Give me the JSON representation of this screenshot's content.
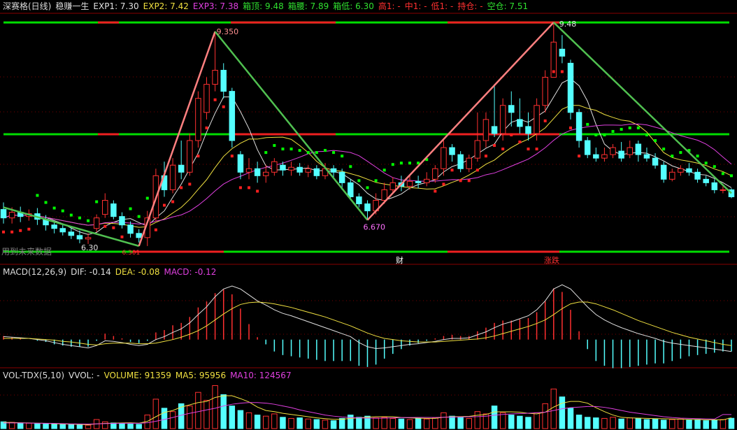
{
  "main_header": {
    "title": "深赛格(日线)",
    "indicator": "稳赚一生",
    "items": [
      {
        "label": "EXP1: 7.30",
        "color": "#e0e0e0"
      },
      {
        "label": "EXP2: 7.42",
        "color": "#f0e040"
      },
      {
        "label": "EXP3: 7.38",
        "color": "#e040e0"
      },
      {
        "label": "箱顶: 9.48",
        "color": "#30e030"
      },
      {
        "label": "箱腰: 7.89",
        "color": "#30e030"
      },
      {
        "label": "箱低: 6.30",
        "color": "#30e030"
      },
      {
        "label": "高1: -",
        "color": "#ff3030"
      },
      {
        "label": "中1: -",
        "color": "#ff3030"
      },
      {
        "label": "低1: -",
        "color": "#ff3030"
      },
      {
        "label": "持仓: -",
        "color": "#ff3030"
      },
      {
        "label": "空仓: 7.51",
        "color": "#30e030"
      }
    ]
  },
  "macd_header": {
    "name": "MACD(12,26,9)",
    "items": [
      {
        "label": "DIF: -0.14",
        "color": "#e0e0e0"
      },
      {
        "label": "DEA: -0.08",
        "color": "#f0e040"
      },
      {
        "label": "MACD: -0.12",
        "color": "#e040e0"
      }
    ]
  },
  "vol_header": {
    "name": "VOL-TDX(5,10)",
    "items": [
      {
        "label": "VVOL: -",
        "color": "#e0e0e0"
      },
      {
        "label": "VOLUME: 91359",
        "color": "#f0e040"
      },
      {
        "label": "MA5: 95956",
        "color": "#f0e040"
      },
      {
        "label": "MA10: 124567",
        "color": "#e040e0"
      }
    ]
  },
  "annotations": {
    "low_left": "6.30",
    "peak_left": "9.350",
    "trough_mid": "6.670",
    "peak_right": "9.48",
    "low_left_label2": "6.301",
    "note_left": "用到未来数据",
    "marker_cai": "财",
    "marker_zd": "涨跌"
  },
  "colors": {
    "up": "#ff3030",
    "down": "#54ffff",
    "box_line": "#00dd00",
    "box_line_red": "#ee2020",
    "zigzag_up": "#ff8080",
    "zigzag_down": "#50c050",
    "dots_green": "#00ff00",
    "dots_red": "#ff2020",
    "exp1": "#e0e0e0",
    "exp2": "#f0e040",
    "exp3": "#e040e0",
    "grid": "#7a0000"
  },
  "chart_data": {
    "type": "candlestick",
    "price_range": [
      6.1,
      9.6
    ],
    "box": {
      "top": 9.48,
      "mid": 7.89,
      "low": 6.3
    },
    "zigzag": [
      {
        "i": 0,
        "v": 6.85
      },
      {
        "i": 16,
        "v": 6.3
      },
      {
        "i": 25,
        "v": 9.35
      },
      {
        "i": 43,
        "v": 6.67
      },
      {
        "i": 65,
        "v": 9.48
      },
      {
        "i": 86,
        "v": 7.05
      }
    ],
    "candles": [
      [
        6.82,
        6.7,
        6.92,
        6.62
      ],
      [
        6.7,
        6.78,
        6.85,
        6.62
      ],
      [
        6.78,
        6.72,
        6.86,
        6.64
      ],
      [
        6.72,
        6.76,
        6.82,
        6.66
      ],
      [
        6.76,
        6.68,
        6.84,
        6.6
      ],
      [
        6.68,
        6.6,
        6.74,
        6.52
      ],
      [
        6.6,
        6.55,
        6.66,
        6.48
      ],
      [
        6.55,
        6.5,
        6.62,
        6.45
      ],
      [
        6.5,
        6.45,
        6.56,
        6.4
      ],
      [
        6.45,
        6.4,
        6.52,
        6.34
      ],
      [
        6.4,
        6.42,
        6.48,
        6.33
      ],
      [
        6.55,
        6.7,
        6.75,
        6.5
      ],
      [
        6.75,
        6.95,
        7.05,
        6.7
      ],
      [
        6.9,
        6.72,
        6.95,
        6.68
      ],
      [
        6.72,
        6.6,
        6.78,
        6.55
      ],
      [
        6.6,
        6.48,
        6.65,
        6.42
      ],
      [
        6.48,
        6.42,
        6.54,
        6.35
      ],
      [
        6.42,
        6.7,
        6.8,
        6.3
      ],
      [
        6.7,
        7.3,
        7.4,
        6.65
      ],
      [
        7.3,
        7.1,
        7.5,
        7.0
      ],
      [
        7.1,
        7.45,
        7.55,
        7.05
      ],
      [
        7.45,
        7.35,
        7.8,
        7.25
      ],
      [
        7.35,
        7.8,
        7.9,
        7.3
      ],
      [
        7.8,
        8.4,
        8.5,
        7.7
      ],
      [
        8.2,
        8.6,
        8.7,
        8.1
      ],
      [
        8.6,
        8.8,
        9.35,
        8.5
      ],
      [
        8.8,
        8.5,
        8.9,
        8.4
      ],
      [
        8.5,
        7.8,
        8.55,
        7.7
      ],
      [
        7.6,
        7.35,
        7.65,
        7.25
      ],
      [
        7.35,
        7.4,
        7.55,
        7.25
      ],
      [
        7.4,
        7.3,
        7.5,
        7.2
      ],
      [
        7.3,
        7.35,
        7.45,
        7.2
      ],
      [
        7.35,
        7.5,
        7.55,
        7.3
      ],
      [
        7.45,
        7.38,
        7.5,
        7.3
      ],
      [
        7.38,
        7.42,
        7.5,
        7.3
      ],
      [
        7.42,
        7.35,
        7.48,
        7.3
      ],
      [
        7.35,
        7.4,
        7.45,
        7.28
      ],
      [
        7.4,
        7.3,
        7.45,
        7.25
      ],
      [
        7.3,
        7.4,
        7.48,
        7.25
      ],
      [
        7.4,
        7.35,
        7.45,
        7.28
      ],
      [
        7.35,
        7.2,
        7.4,
        7.1
      ],
      [
        7.2,
        7.0,
        7.25,
        6.95
      ],
      [
        7.0,
        6.9,
        7.05,
        6.85
      ],
      [
        6.9,
        6.8,
        6.95,
        6.67
      ],
      [
        6.8,
        6.95,
        7.05,
        6.75
      ],
      [
        6.95,
        7.1,
        7.2,
        6.9
      ],
      [
        7.1,
        7.2,
        7.28,
        7.05
      ],
      [
        7.2,
        7.15,
        7.3,
        7.08
      ],
      [
        7.15,
        7.22,
        7.3,
        7.1
      ],
      [
        7.22,
        7.2,
        7.3,
        7.12
      ],
      [
        7.2,
        7.25,
        7.35,
        7.15
      ],
      [
        7.25,
        7.4,
        7.45,
        7.2
      ],
      [
        7.4,
        7.7,
        7.8,
        7.3
      ],
      [
        7.7,
        7.6,
        7.75,
        7.5
      ],
      [
        7.6,
        7.4,
        7.65,
        7.35
      ],
      [
        7.4,
        7.55,
        7.6,
        7.35
      ],
      [
        7.55,
        7.8,
        8.2,
        7.5
      ],
      [
        7.8,
        8.1,
        8.2,
        7.7
      ],
      [
        8.0,
        7.9,
        8.6,
        7.85
      ],
      [
        7.9,
        8.3,
        8.4,
        7.8
      ],
      [
        8.3,
        8.2,
        8.5,
        8.0
      ],
      [
        8.1,
        8.0,
        8.4,
        7.9
      ],
      [
        8.0,
        7.9,
        8.2,
        7.8
      ],
      [
        7.9,
        8.3,
        8.4,
        7.8
      ],
      [
        8.3,
        8.7,
        8.8,
        8.2
      ],
      [
        8.7,
        9.2,
        9.48,
        8.9
      ],
      [
        9.1,
        9.0,
        9.3,
        8.9
      ],
      [
        8.9,
        8.2,
        8.95,
        8.1
      ],
      [
        8.2,
        7.8,
        8.25,
        7.7
      ],
      [
        7.8,
        7.6,
        7.85,
        7.55
      ],
      [
        7.6,
        7.55,
        7.7,
        7.5
      ],
      [
        7.55,
        7.6,
        7.7,
        7.5
      ],
      [
        7.6,
        7.7,
        7.75,
        7.55
      ],
      [
        7.65,
        7.55,
        7.78,
        7.5
      ],
      [
        7.6,
        7.7,
        7.8,
        7.55
      ],
      [
        7.75,
        7.6,
        7.8,
        7.5
      ],
      [
        7.6,
        7.55,
        7.7,
        7.5
      ],
      [
        7.55,
        7.45,
        7.62,
        7.4
      ],
      [
        7.45,
        7.25,
        7.5,
        7.2
      ],
      [
        7.25,
        7.35,
        7.4,
        7.22
      ],
      [
        7.35,
        7.4,
        7.45,
        7.3
      ],
      [
        7.4,
        7.35,
        7.48,
        7.3
      ],
      [
        7.35,
        7.25,
        7.4,
        7.2
      ],
      [
        7.25,
        7.2,
        7.3,
        7.15
      ],
      [
        7.2,
        7.1,
        7.25,
        7.05
      ],
      [
        7.1,
        7.1,
        7.15,
        7.05
      ],
      [
        7.1,
        7.0,
        7.12,
        6.98
      ]
    ],
    "macd_range": [
      -0.45,
      1.1
    ],
    "dif": [
      0.05,
      0.04,
      0.03,
      0.02,
      0.0,
      -0.02,
      -0.05,
      -0.08,
      -0.1,
      -0.12,
      -0.14,
      -0.1,
      -0.02,
      -0.03,
      -0.05,
      -0.08,
      -0.1,
      -0.08,
      0.0,
      0.05,
      0.12,
      0.18,
      0.28,
      0.42,
      0.55,
      0.72,
      0.85,
      0.9,
      0.85,
      0.75,
      0.65,
      0.58,
      0.5,
      0.44,
      0.4,
      0.35,
      0.3,
      0.25,
      0.2,
      0.15,
      0.1,
      0.05,
      -0.05,
      -0.12,
      -0.15,
      -0.14,
      -0.12,
      -0.1,
      -0.08,
      -0.07,
      -0.05,
      -0.03,
      0.0,
      0.02,
      0.02,
      0.03,
      0.08,
      0.13,
      0.2,
      0.26,
      0.3,
      0.35,
      0.4,
      0.5,
      0.65,
      0.85,
      0.92,
      0.85,
      0.7,
      0.55,
      0.42,
      0.33,
      0.26,
      0.2,
      0.15,
      0.1,
      0.06,
      0.02,
      -0.03,
      -0.06,
      -0.08,
      -0.1,
      -0.12,
      -0.14,
      -0.16,
      -0.18,
      -0.2
    ],
    "dea": [
      0.02,
      0.02,
      0.02,
      0.02,
      0.01,
      0.0,
      -0.01,
      -0.03,
      -0.04,
      -0.06,
      -0.08,
      -0.09,
      -0.07,
      -0.06,
      -0.06,
      -0.06,
      -0.07,
      -0.07,
      -0.06,
      -0.03,
      0.0,
      0.04,
      0.09,
      0.15,
      0.23,
      0.33,
      0.43,
      0.52,
      0.59,
      0.62,
      0.63,
      0.62,
      0.6,
      0.57,
      0.54,
      0.5,
      0.46,
      0.42,
      0.38,
      0.33,
      0.28,
      0.23,
      0.17,
      0.11,
      0.06,
      0.02,
      0.0,
      -0.02,
      -0.03,
      -0.04,
      -0.04,
      -0.04,
      -0.03,
      -0.02,
      -0.01,
      0.0,
      0.01,
      0.03,
      0.06,
      0.1,
      0.14,
      0.18,
      0.22,
      0.27,
      0.33,
      0.42,
      0.52,
      0.6,
      0.63,
      0.63,
      0.6,
      0.55,
      0.5,
      0.44,
      0.38,
      0.32,
      0.27,
      0.22,
      0.17,
      0.12,
      0.08,
      0.04,
      0.01,
      -0.02,
      -0.05,
      -0.08,
      -0.1
    ],
    "macd_hist": [
      0.06,
      0.04,
      0.02,
      0.0,
      -0.02,
      -0.04,
      -0.08,
      -0.1,
      -0.12,
      -0.12,
      -0.12,
      -0.02,
      0.1,
      0.06,
      0.02,
      -0.04,
      -0.06,
      -0.02,
      0.12,
      0.16,
      0.24,
      0.28,
      0.38,
      0.54,
      0.64,
      0.78,
      0.84,
      0.76,
      0.52,
      0.26,
      0.04,
      -0.08,
      -0.2,
      -0.26,
      -0.28,
      -0.3,
      -0.32,
      -0.34,
      -0.36,
      -0.36,
      -0.36,
      -0.36,
      -0.44,
      -0.46,
      -0.42,
      -0.32,
      -0.24,
      -0.16,
      -0.1,
      -0.06,
      -0.02,
      0.02,
      0.06,
      0.08,
      0.06,
      0.06,
      0.14,
      0.2,
      0.28,
      0.32,
      0.32,
      0.34,
      0.36,
      0.46,
      0.64,
      0.86,
      0.8,
      0.5,
      0.14,
      -0.16,
      -0.36,
      -0.44,
      -0.48,
      -0.48,
      -0.46,
      -0.44,
      -0.42,
      -0.4,
      -0.4,
      -0.36,
      -0.32,
      -0.28,
      -0.26,
      -0.24,
      -0.22,
      -0.2,
      -0.2
    ],
    "volume_max": 420000,
    "volume": [
      60000,
      55000,
      50000,
      48000,
      45000,
      42000,
      40000,
      38000,
      35000,
      33000,
      30000,
      80000,
      60000,
      50000,
      45000,
      40000,
      38000,
      120000,
      260000,
      180000,
      150000,
      220000,
      200000,
      320000,
      250000,
      380000,
      300000,
      200000,
      160000,
      140000,
      120000,
      110000,
      130000,
      100000,
      90000,
      95000,
      85000,
      80000,
      75000,
      70000,
      90000,
      120000,
      100000,
      110000,
      95000,
      100000,
      90000,
      85000,
      80000,
      90000,
      85000,
      95000,
      140000,
      110000,
      100000,
      90000,
      150000,
      130000,
      200000,
      140000,
      120000,
      110000,
      100000,
      140000,
      220000,
      350000,
      280000,
      180000,
      120000,
      100000,
      95000,
      90000,
      100000,
      85000,
      95000,
      90000,
      80000,
      85000,
      75000,
      80000,
      85000,
      75000,
      80000,
      70000,
      75000,
      80000,
      91359
    ],
    "vol_ma5": [
      55000,
      54000,
      52000,
      50000,
      48000,
      46000,
      43000,
      41000,
      39000,
      37000,
      35000,
      42000,
      46000,
      48000,
      50000,
      52000,
      48000,
      64000,
      105000,
      143000,
      160000,
      190000,
      210000,
      230000,
      240000,
      275000,
      290000,
      290000,
      265000,
      235000,
      190000,
      160000,
      150000,
      135000,
      125000,
      115000,
      105000,
      95000,
      88000,
      82000,
      82000,
      90000,
      95000,
      100000,
      105000,
      105000,
      105000,
      98000,
      95000,
      92000,
      90000,
      90000,
      100000,
      105000,
      106000,
      108000,
      118000,
      124000,
      148000,
      148000,
      148000,
      145000,
      135000,
      130000,
      145000,
      190000,
      225000,
      240000,
      240000,
      225000,
      185000,
      150000,
      120000,
      100000,
      95000,
      93000,
      90000,
      88000,
      87000,
      85000,
      83000,
      80000,
      80000,
      78000,
      78000,
      77000,
      95956
    ],
    "vol_ma10": [
      50000,
      50000,
      50000,
      49000,
      48000,
      47000,
      46000,
      44000,
      42000,
      41000,
      40000,
      42000,
      44000,
      46000,
      47000,
      48000,
      47000,
      52000,
      65000,
      80000,
      98000,
      118000,
      135000,
      150000,
      165000,
      180000,
      200000,
      215000,
      225000,
      230000,
      230000,
      225000,
      215000,
      200000,
      185000,
      165000,
      150000,
      135000,
      120000,
      110000,
      103000,
      98000,
      95000,
      93000,
      92000,
      93000,
      95000,
      97000,
      98000,
      99000,
      99000,
      98000,
      100000,
      102000,
      103000,
      104000,
      106000,
      110000,
      118000,
      125000,
      130000,
      133000,
      136000,
      140000,
      145000,
      160000,
      175000,
      185000,
      190000,
      195000,
      195000,
      188000,
      175000,
      160000,
      145000,
      135000,
      125000,
      115000,
      105000,
      98000,
      93000,
      90000,
      88000,
      86000,
      84000,
      124567,
      124567
    ]
  }
}
